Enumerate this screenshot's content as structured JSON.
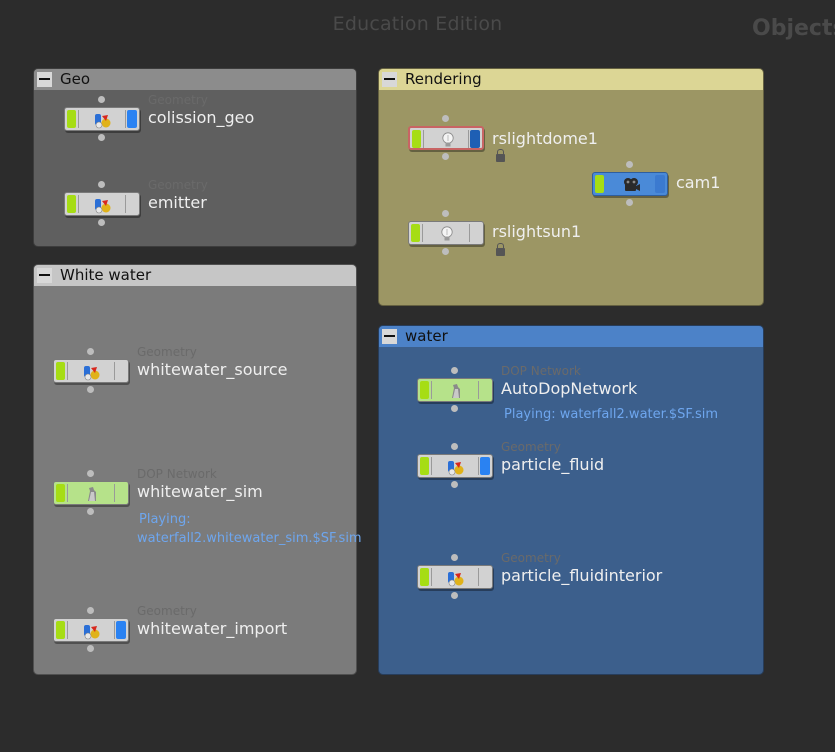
{
  "watermark": "Education Edition",
  "context_label": "Objects",
  "boxes": {
    "geo": {
      "title": "Geo",
      "nodes": [
        {
          "type": "Geometry",
          "name": "colission_geo"
        },
        {
          "type": "Geometry",
          "name": "emitter"
        }
      ]
    },
    "rendering": {
      "title": "Rendering",
      "nodes": [
        {
          "name": "rslightdome1"
        },
        {
          "name": "cam1"
        },
        {
          "name": "rslightsun1"
        }
      ]
    },
    "whitewater": {
      "title": "White water",
      "nodes": [
        {
          "type": "Geometry",
          "name": "whitewater_source"
        },
        {
          "type": "DOP Network",
          "name": "whitewater_sim",
          "status_1": "Playing:",
          "status_2": "waterfall2.whitewater_sim.$SF.sim"
        },
        {
          "type": "Geometry",
          "name": "whitewater_import"
        }
      ]
    },
    "water": {
      "title": "water",
      "nodes": [
        {
          "type": "DOP Network",
          "name": "AutoDopNetwork",
          "status": "Playing: waterfall2.water.$SF.sim"
        },
        {
          "type": "Geometry",
          "name": "particle_fluid"
        },
        {
          "type": "Geometry",
          "name": "particle_fluidinterior"
        }
      ]
    }
  },
  "colors": {
    "background": "#2c2c2c",
    "geo_box": "#5f5f5f",
    "geo_header": "#8c8c8c",
    "rendering_box": "#9c9664",
    "rendering_header": "#dcd695",
    "whitewater_box": "#7b7b7b",
    "whitewater_header": "#c6c6c6",
    "water_box": "#3c5f8c",
    "water_header": "#4c82c8",
    "display_flag": "#a6dd14",
    "render_flag": "#2a82f2",
    "status_text": "#6ea6ee"
  }
}
